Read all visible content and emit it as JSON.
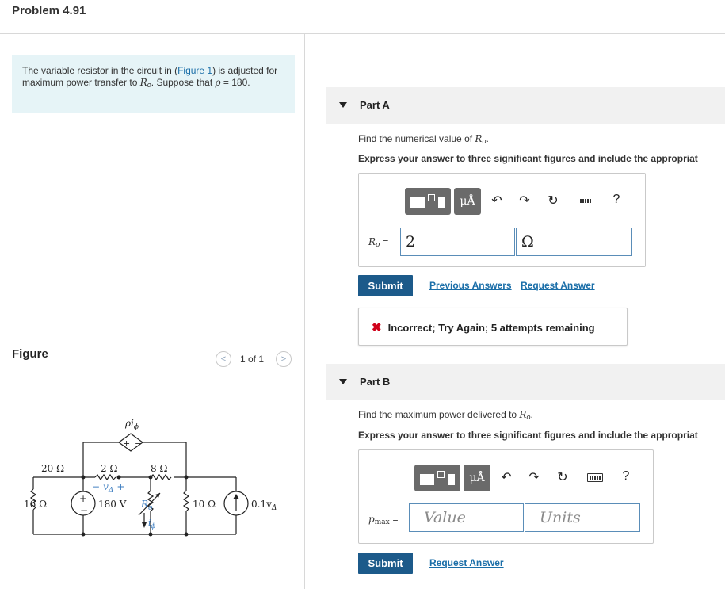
{
  "page": {
    "title": "Problem 4.91"
  },
  "problem": {
    "text_1": "The variable resistor in the circuit in (",
    "figure_link": "Figure 1",
    "text_2": ") is adjusted for maximum power transfer to ",
    "var_R": "R",
    "var_R_sub": "o",
    "text_3": ". Suppose that ",
    "var_rho": "ρ",
    "text_4": " = 180."
  },
  "figure": {
    "label": "Figure",
    "counter": "1 of 1",
    "prev_icon": "chevron-left-icon",
    "next_icon": "chevron-right-icon",
    "circuit": {
      "dep_source_label": "ρi",
      "dep_source_label_sub": "ϕ",
      "r20": "20 Ω",
      "r2": "2 Ω",
      "r8": "8 Ω",
      "r16": "16 Ω",
      "vsrc": "180 V",
      "ro_label": "R",
      "ro_sub": "o",
      "r10": "10 Ω",
      "isrc": "0.1v",
      "isrc_sub": "Δ",
      "vd_minus": "−",
      "vd": "v",
      "vd_sub": "Δ",
      "vd_plus": "+",
      "i_phi": "i",
      "i_phi_sub": "ϕ",
      "plus": "+",
      "minus": "−"
    }
  },
  "partA": {
    "title": "Part A",
    "question_1": "Find the numerical value of ",
    "question_var": "R",
    "question_sub": "o",
    "question_2": ".",
    "instruction": "Express your answer to three significant figures and include the appropriat",
    "toolbar": {
      "templates_icon": "templates-icon",
      "units": "μÅ",
      "undo": "undo-icon",
      "redo": "redo-icon",
      "reset": "reset-icon",
      "keyboard": "keyboard-icon",
      "help": "?"
    },
    "var_label": "R",
    "var_sub": "o",
    "equals": "=",
    "value": "2",
    "units": "Ω",
    "submit": "Submit",
    "previous_answers": "Previous Answers",
    "request_answer": "Request Answer",
    "feedback": "Incorrect; Try Again; 5 attempts remaining",
    "feedback_icon": "✖"
  },
  "partB": {
    "title": "Part B",
    "question_1": "Find the maximum power delivered to ",
    "question_var": "R",
    "question_sub": "o",
    "question_2": ".",
    "instruction": "Express your answer to three significant figures and include the appropriat",
    "toolbar": {
      "units": "μÅ",
      "help": "?"
    },
    "var_label": "p",
    "var_sub": "max",
    "equals": "=",
    "value_placeholder": "Value",
    "units_placeholder": "Units",
    "submit": "Submit",
    "request_answer": "Request Answer"
  },
  "colors": {
    "accent": "#1c5a8a",
    "link": "#1a6ea8",
    "problem_bg": "#e6f4f7",
    "error": "#d0021b"
  }
}
